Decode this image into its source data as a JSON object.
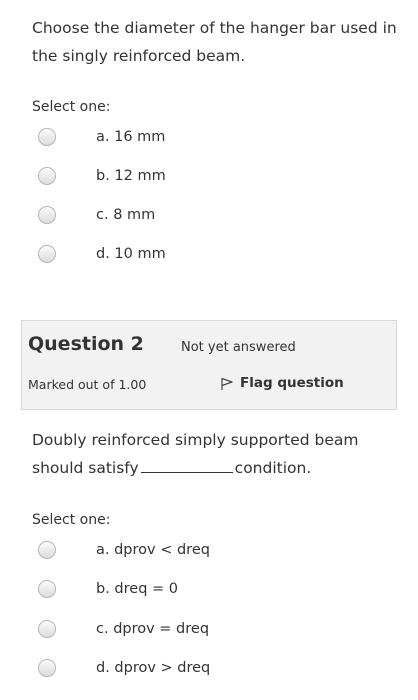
{
  "question1": {
    "text": "Choose the diameter of the hanger bar used in the singly reinforced beam.",
    "select_label": "Select one:",
    "options": [
      {
        "label": "a. 16 mm"
      },
      {
        "label": "b. 12 mm"
      },
      {
        "label": "c. 8 mm"
      },
      {
        "label": "d. 10 mm"
      }
    ]
  },
  "question2_info": {
    "title": "Question 2",
    "state": "Not yet answered",
    "marks": "Marked out of 1.00",
    "flag_label": "Flag question"
  },
  "question2": {
    "text_part1": "Doubly reinforced simply supported beam should satisfy",
    "text_part2": "condition.",
    "select_label": "Select one:",
    "options": [
      {
        "label": "a. dprov < dreq"
      },
      {
        "label": "b. dreq = 0"
      },
      {
        "label": "c. dprov = dreq"
      },
      {
        "label": "d. dprov > dreq"
      }
    ]
  }
}
